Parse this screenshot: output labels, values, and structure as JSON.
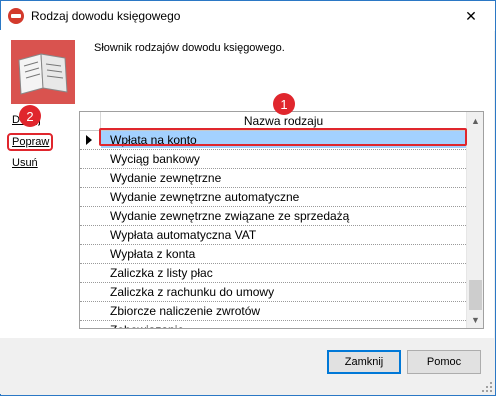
{
  "window": {
    "title": "Rodzaj dowodu księgowego",
    "close_glyph": "✕"
  },
  "header": {
    "description": "Słownik rodzajów dowodu księgowego.",
    "icon": "book-icon"
  },
  "side_actions": [
    {
      "label": "Dodaj"
    },
    {
      "label": "Popraw"
    },
    {
      "label": "Usuń"
    }
  ],
  "badges": {
    "first": "1",
    "second": "2"
  },
  "grid": {
    "column_header": "Nazwa rodzaju",
    "selected_index": 0,
    "rows": [
      "Wpłata na konto",
      "Wyciąg bankowy",
      "Wydanie zewnętrzne",
      "Wydanie zewnętrzne automatyczne",
      "Wydanie zewnętrzne związane ze sprzedażą",
      "Wypłata automatyczna VAT",
      "Wypłata z konta",
      "Zaliczka z listy płac",
      "Zaliczka z rachunku do umowy",
      "Zbiorcze naliczenie zwrotów",
      "Zobowiązanie"
    ]
  },
  "footer": {
    "close_button": "Zamknij",
    "help_button": "Pomoc"
  },
  "colors": {
    "accent": "#e0262d",
    "selection": "#3399ff",
    "border": "#2b78c5"
  }
}
